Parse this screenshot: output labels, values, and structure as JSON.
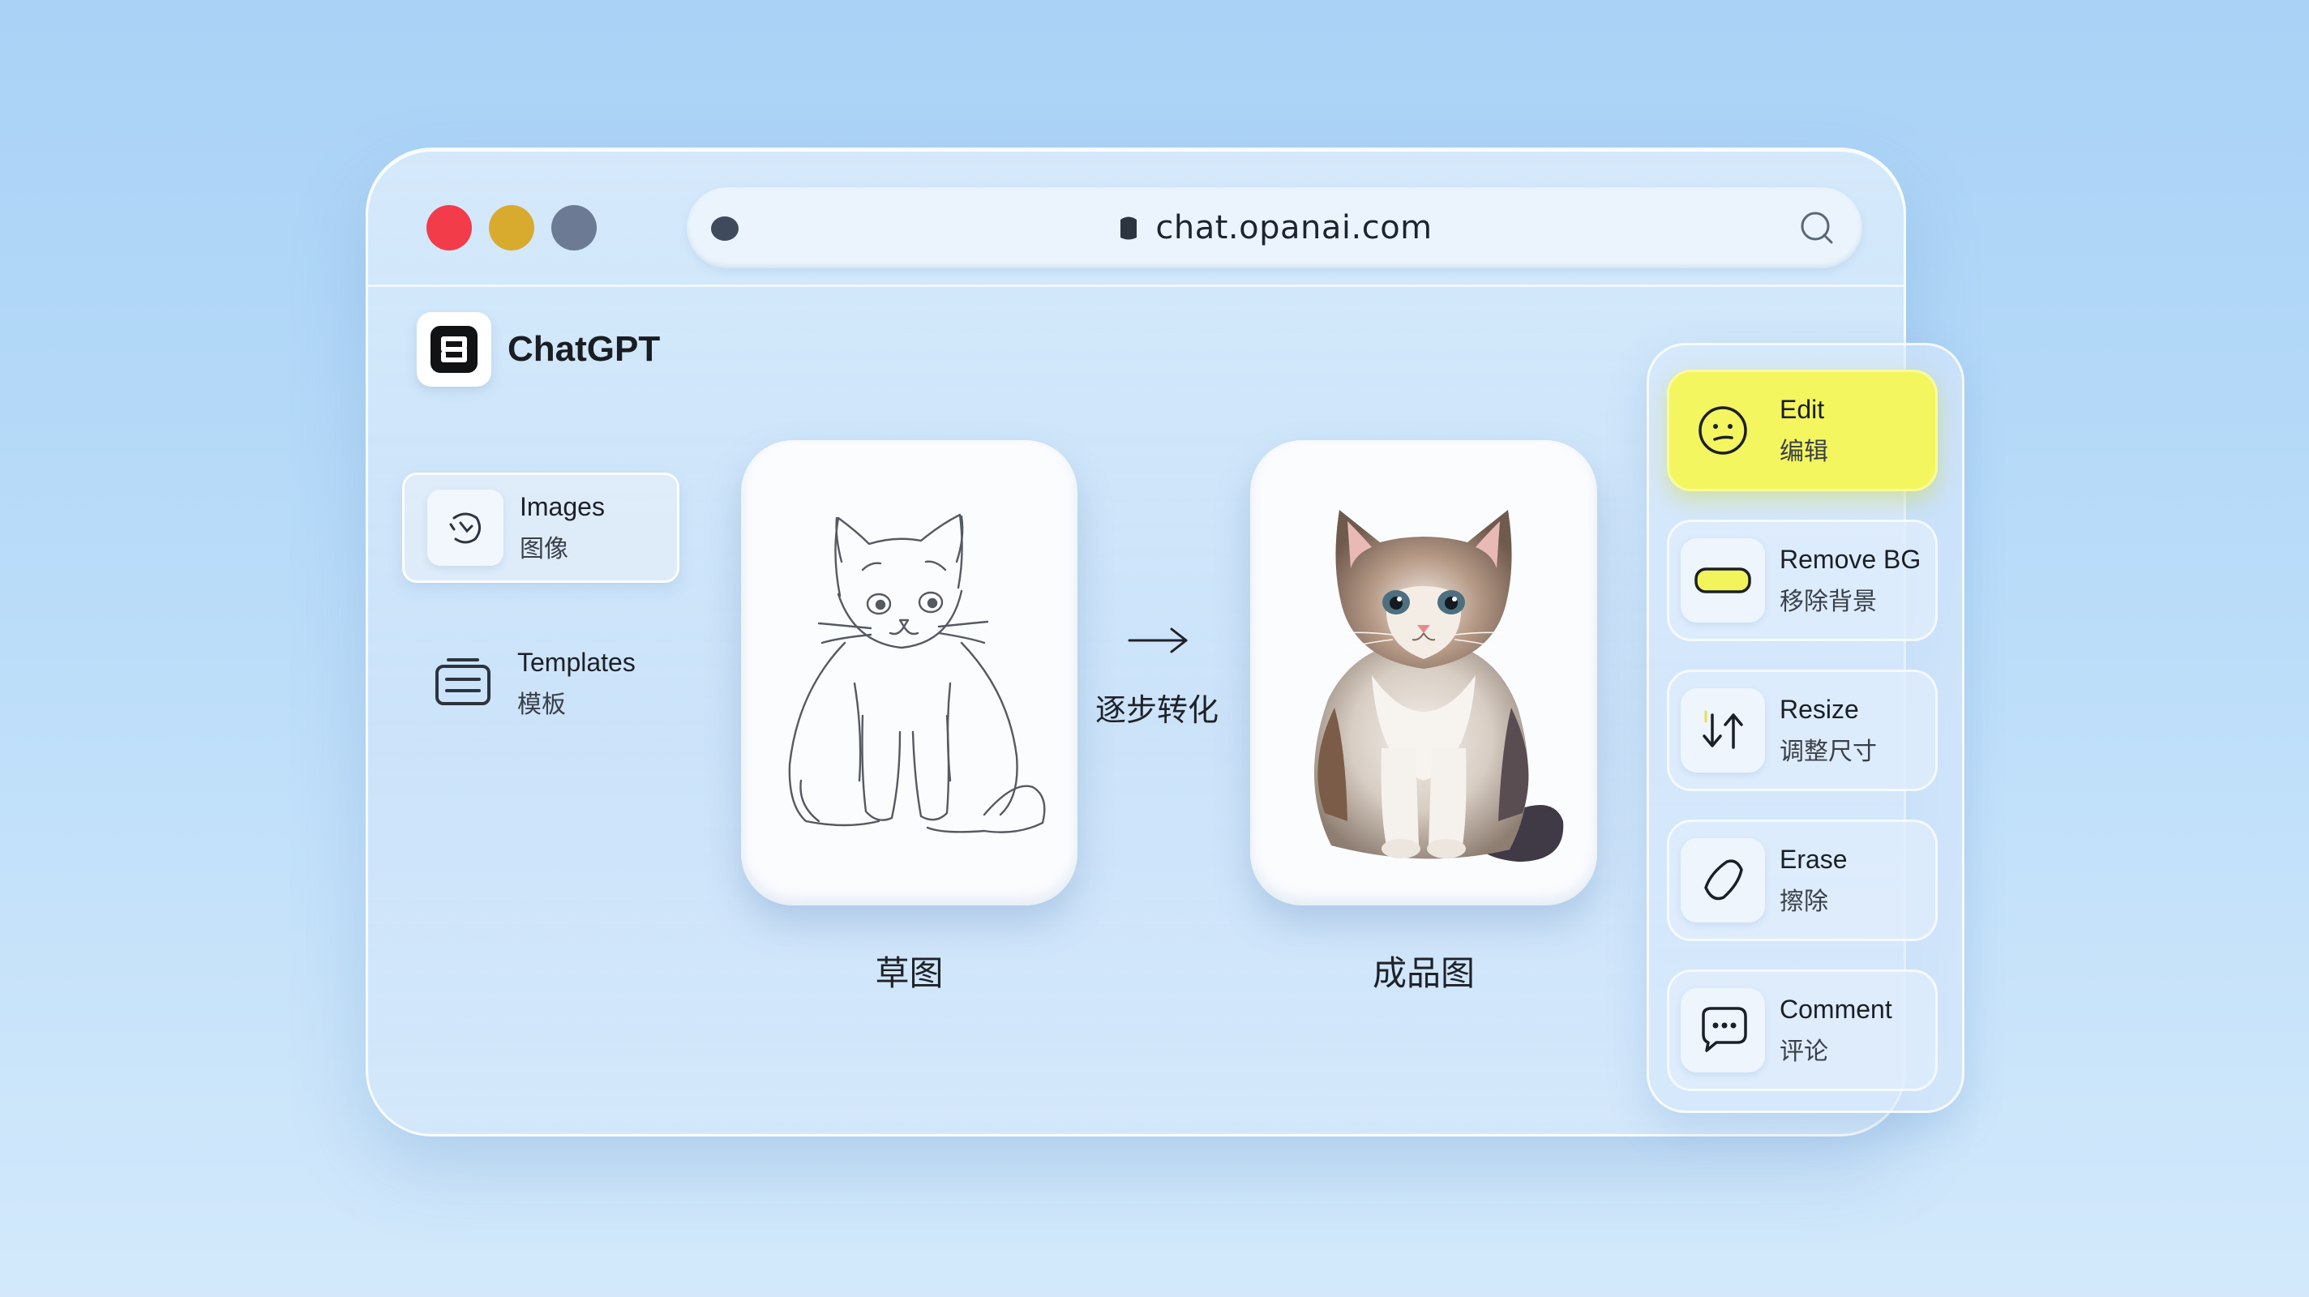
{
  "window": {
    "traffic_lights": [
      "close",
      "minimize",
      "maximize"
    ],
    "colors": {
      "close": "#f23c4a",
      "minimize": "#d8aa2e",
      "maximize": "#6c7a93"
    }
  },
  "address_bar": {
    "url": "chat.opanai.com"
  },
  "brand": {
    "name": "ChatGPT",
    "icon": "chatgpt-logo-icon"
  },
  "sidebar": {
    "items": [
      {
        "label": "Images",
        "label_zh": "图像",
        "icon": "image-icon",
        "active": true
      },
      {
        "label": "Templates",
        "label_zh": "模板",
        "icon": "template-icon",
        "active": false
      }
    ]
  },
  "main": {
    "sketch_caption": "草图",
    "final_caption": "成品图",
    "transition_label": "逐步转化"
  },
  "tools": {
    "accent": "#f3f65e",
    "items": [
      {
        "label": "Edit",
        "label_zh": "编辑",
        "icon": "face-icon",
        "active": true
      },
      {
        "label": "Remove BG",
        "label_zh": "移除背景",
        "icon": "pill-icon",
        "active": false
      },
      {
        "label": "Resize",
        "label_zh": "调整尺寸",
        "icon": "resize-arrows-icon",
        "active": false
      },
      {
        "label": "Erase",
        "label_zh": "擦除",
        "icon": "eraser-icon",
        "active": false
      },
      {
        "label": "Comment",
        "label_zh": "评论",
        "icon": "comment-icon",
        "active": false
      }
    ]
  }
}
